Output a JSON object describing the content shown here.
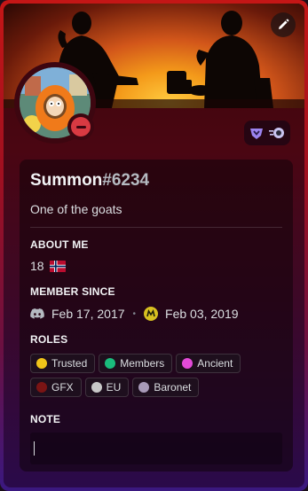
{
  "profile": {
    "username": "Summon",
    "discriminator": "#6234",
    "custom_status": "One of the goats"
  },
  "about": {
    "title": "About Me",
    "age": "18",
    "flag_icon": "norway-flag-icon"
  },
  "member_since": {
    "title": "Member Since",
    "discord_date": "Feb 17, 2017",
    "server_date": "Feb 03, 2019",
    "separator": "•"
  },
  "roles": {
    "title": "Roles",
    "items": [
      {
        "name": "Trusted",
        "color": "#f0c419"
      },
      {
        "name": "Members",
        "color": "#1abc7c"
      },
      {
        "name": "Ancient",
        "color": "#e34ad8"
      },
      {
        "name": "GFX",
        "color": "#7a1414"
      },
      {
        "name": "EU",
        "color": "#c8c8c8"
      },
      {
        "name": "Baronet",
        "color": "#a89ab8"
      }
    ]
  },
  "note": {
    "title": "Note",
    "value": ""
  },
  "colors": {
    "status_dnd": "#d83a42",
    "accent_gradient_top": "#c41616",
    "accent_gradient_bottom": "#3a1880"
  }
}
